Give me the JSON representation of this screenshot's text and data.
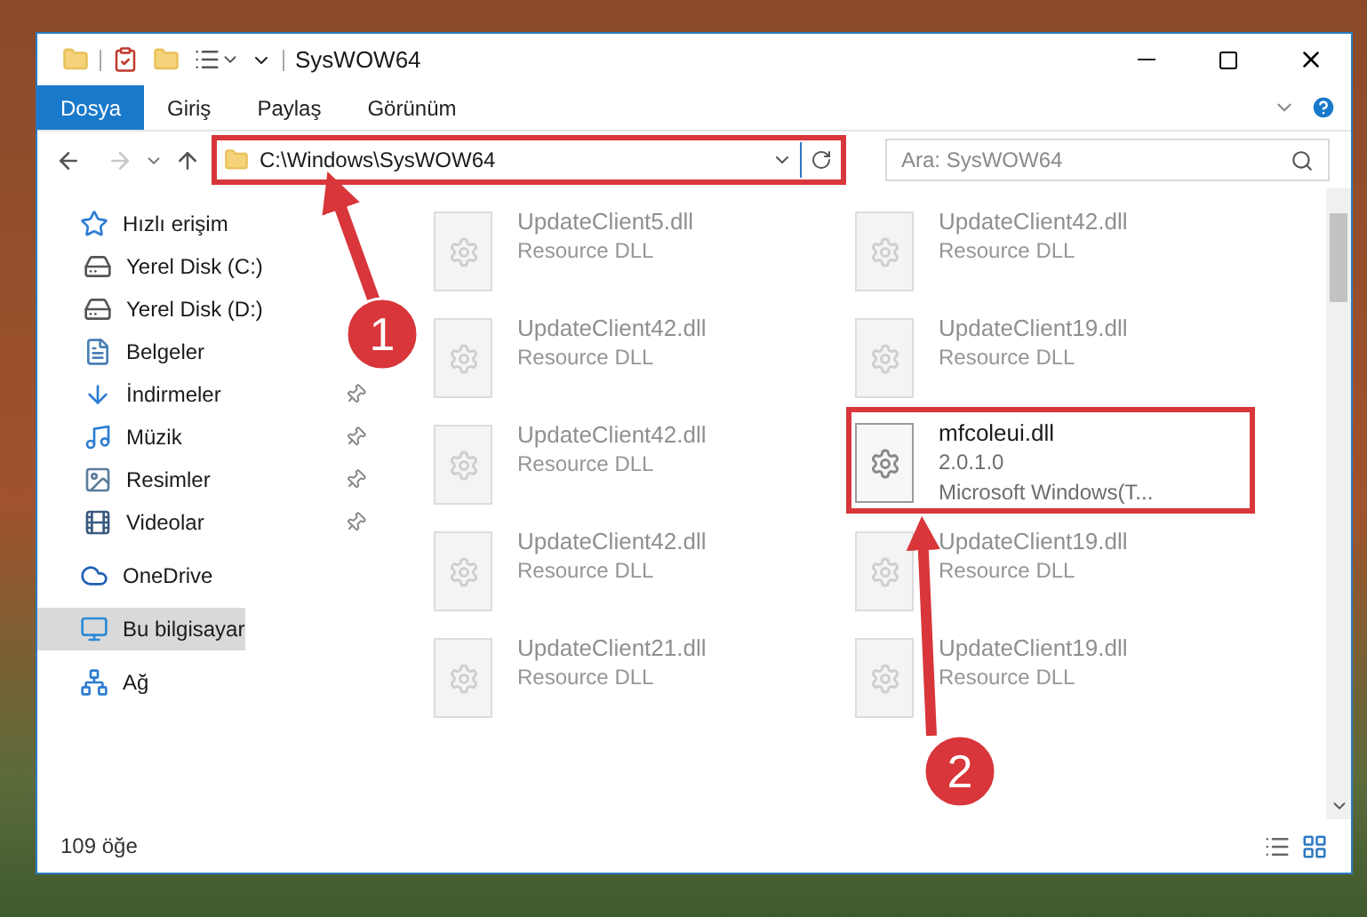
{
  "window": {
    "title": "SysWOW64"
  },
  "ribbon_tabs": [
    {
      "label": "Dosya",
      "selected": true
    },
    {
      "label": "Giriş",
      "selected": false
    },
    {
      "label": "Paylaş",
      "selected": false
    },
    {
      "label": "Görünüm",
      "selected": false
    }
  ],
  "address": {
    "path": "C:\\Windows\\SysWOW64"
  },
  "search": {
    "placeholder": "Ara: SysWOW64"
  },
  "sidebar": {
    "items": [
      {
        "label": "Hızlı erişim",
        "kind": "quick",
        "selected": false,
        "children": [
          {
            "label": "Yerel Disk (C:)",
            "kind": "diskc",
            "pinned": false
          },
          {
            "label": "Yerel Disk (D:)",
            "kind": "disk",
            "pinned": false
          },
          {
            "label": "Belgeler",
            "kind": "docs",
            "pinned": false
          },
          {
            "label": "İndirmeler",
            "kind": "downloads",
            "pinned": true
          },
          {
            "label": "Müzik",
            "kind": "music",
            "pinned": true
          },
          {
            "label": "Resimler",
            "kind": "pictures",
            "pinned": true
          },
          {
            "label": "Videolar",
            "kind": "videos",
            "pinned": true
          }
        ]
      },
      {
        "label": "OneDrive",
        "kind": "cloud",
        "selected": false
      },
      {
        "label": "Bu bilgisayar",
        "kind": "pc",
        "selected": true
      },
      {
        "label": "Ağ",
        "kind": "network",
        "selected": false
      }
    ]
  },
  "files": [
    {
      "name": "UpdateClient5.dll",
      "lines": [
        "Resource DLL"
      ],
      "faded": true
    },
    {
      "name": "UpdateClient42.dll",
      "lines": [
        "Resource DLL"
      ],
      "faded": true
    },
    {
      "name": "UpdateClient42.dll",
      "lines": [
        "Resource DLL"
      ],
      "faded": true
    },
    {
      "name": "UpdateClient19.dll",
      "lines": [
        "Resource DLL"
      ],
      "faded": true
    },
    {
      "name": "UpdateClient42.dll",
      "lines": [
        "Resource DLL"
      ],
      "faded": true
    },
    {
      "name": "mfcoleui.dll",
      "lines": [
        "2.0.1.0",
        "Microsoft Windows(T..."
      ],
      "faded": false
    },
    {
      "name": "UpdateClient42.dll",
      "lines": [
        "Resource DLL"
      ],
      "faded": true
    },
    {
      "name": "UpdateClient19.dll",
      "lines": [
        "Resource DLL"
      ],
      "faded": true
    },
    {
      "name": "UpdateClient21.dll",
      "lines": [
        "Resource DLL"
      ],
      "faded": true
    },
    {
      "name": "UpdateClient19.dll",
      "lines": [
        "Resource DLL"
      ],
      "faded": true
    }
  ],
  "status_bar": {
    "count": "109 öğe"
  },
  "annotations": [
    {
      "label": "1"
    },
    {
      "label": "2"
    }
  ]
}
